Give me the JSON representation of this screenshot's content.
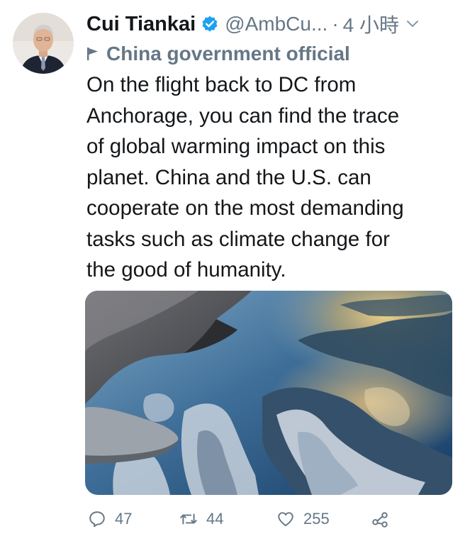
{
  "tweet": {
    "author_name": "Cui Tiankai",
    "handle": "@AmbCu...",
    "separator": "·",
    "time": "4 小時",
    "label": "China government official",
    "text": "On the flight back to DC from\nAnchorage, you can find  the trace\nof global warming impact on this\nplanet. China and the U.S. can\ncooperate on the most demanding\ntasks such as climate change for\nthe good of humanity."
  },
  "actions": {
    "replies": "47",
    "retweets": "44",
    "likes": "255"
  },
  "icons": {
    "verified": "verified-badge-icon",
    "label": "flag-icon",
    "menu": "chevron-down-icon",
    "reply": "reply-icon",
    "retweet": "retweet-icon",
    "like": "heart-icon",
    "share": "share-icon"
  },
  "colors": {
    "verified": "#1da1f2",
    "secondary_text": "#657786",
    "primary_text": "#14171a"
  }
}
